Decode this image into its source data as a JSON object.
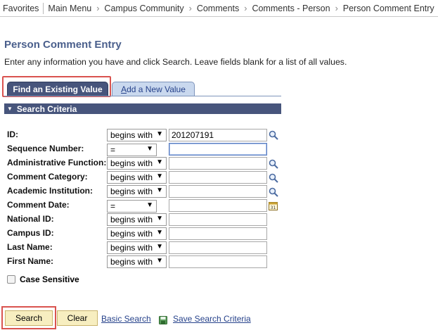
{
  "breadcrumb": {
    "items": [
      "Favorites",
      "Main Menu",
      "Campus Community",
      "Comments",
      "Comments - Person",
      "Person Comment Entry"
    ]
  },
  "page": {
    "title": "Person Comment Entry",
    "instructions": "Enter any information you have and click Search. Leave fields blank for a list of all values."
  },
  "tabs": {
    "find": "Find an Existing Value",
    "add_rest": "dd a New Value",
    "add_first": "A"
  },
  "section": {
    "title": "Search Criteria"
  },
  "fields": [
    {
      "label": "ID:",
      "operator": "begins with",
      "value": "201207191"
    },
    {
      "label": "Sequence Number:",
      "operator": "=",
      "value": ""
    },
    {
      "label": "Administrative Function:",
      "operator": "begins with",
      "value": ""
    },
    {
      "label": "Comment Category:",
      "operator": "begins with",
      "value": ""
    },
    {
      "label": "Academic Institution:",
      "operator": "begins with",
      "value": ""
    },
    {
      "label": "Comment Date:",
      "operator": "=",
      "value": ""
    },
    {
      "label": "National ID:",
      "operator": "begins with",
      "value": ""
    },
    {
      "label": "Campus ID:",
      "operator": "begins with",
      "value": ""
    },
    {
      "label": "Last Name:",
      "operator": "begins with",
      "value": ""
    },
    {
      "label": "First Name:",
      "operator": "begins with",
      "value": ""
    }
  ],
  "case_sensitive": {
    "label": "Case Sensitive",
    "checked": false
  },
  "buttons": {
    "search": "Search",
    "clear": "Clear",
    "basic_search": "Basic Search",
    "save_criteria": "Save Search Criteria"
  },
  "icons": {
    "lookup": "magnifier-icon",
    "calendar": "calendar-icon",
    "save": "save-icon"
  },
  "colors": {
    "accent": "#47557c",
    "title": "#4a5f8c",
    "highlight": "#d9534f",
    "button_bg": "#f7eec0",
    "link": "#26428b"
  }
}
